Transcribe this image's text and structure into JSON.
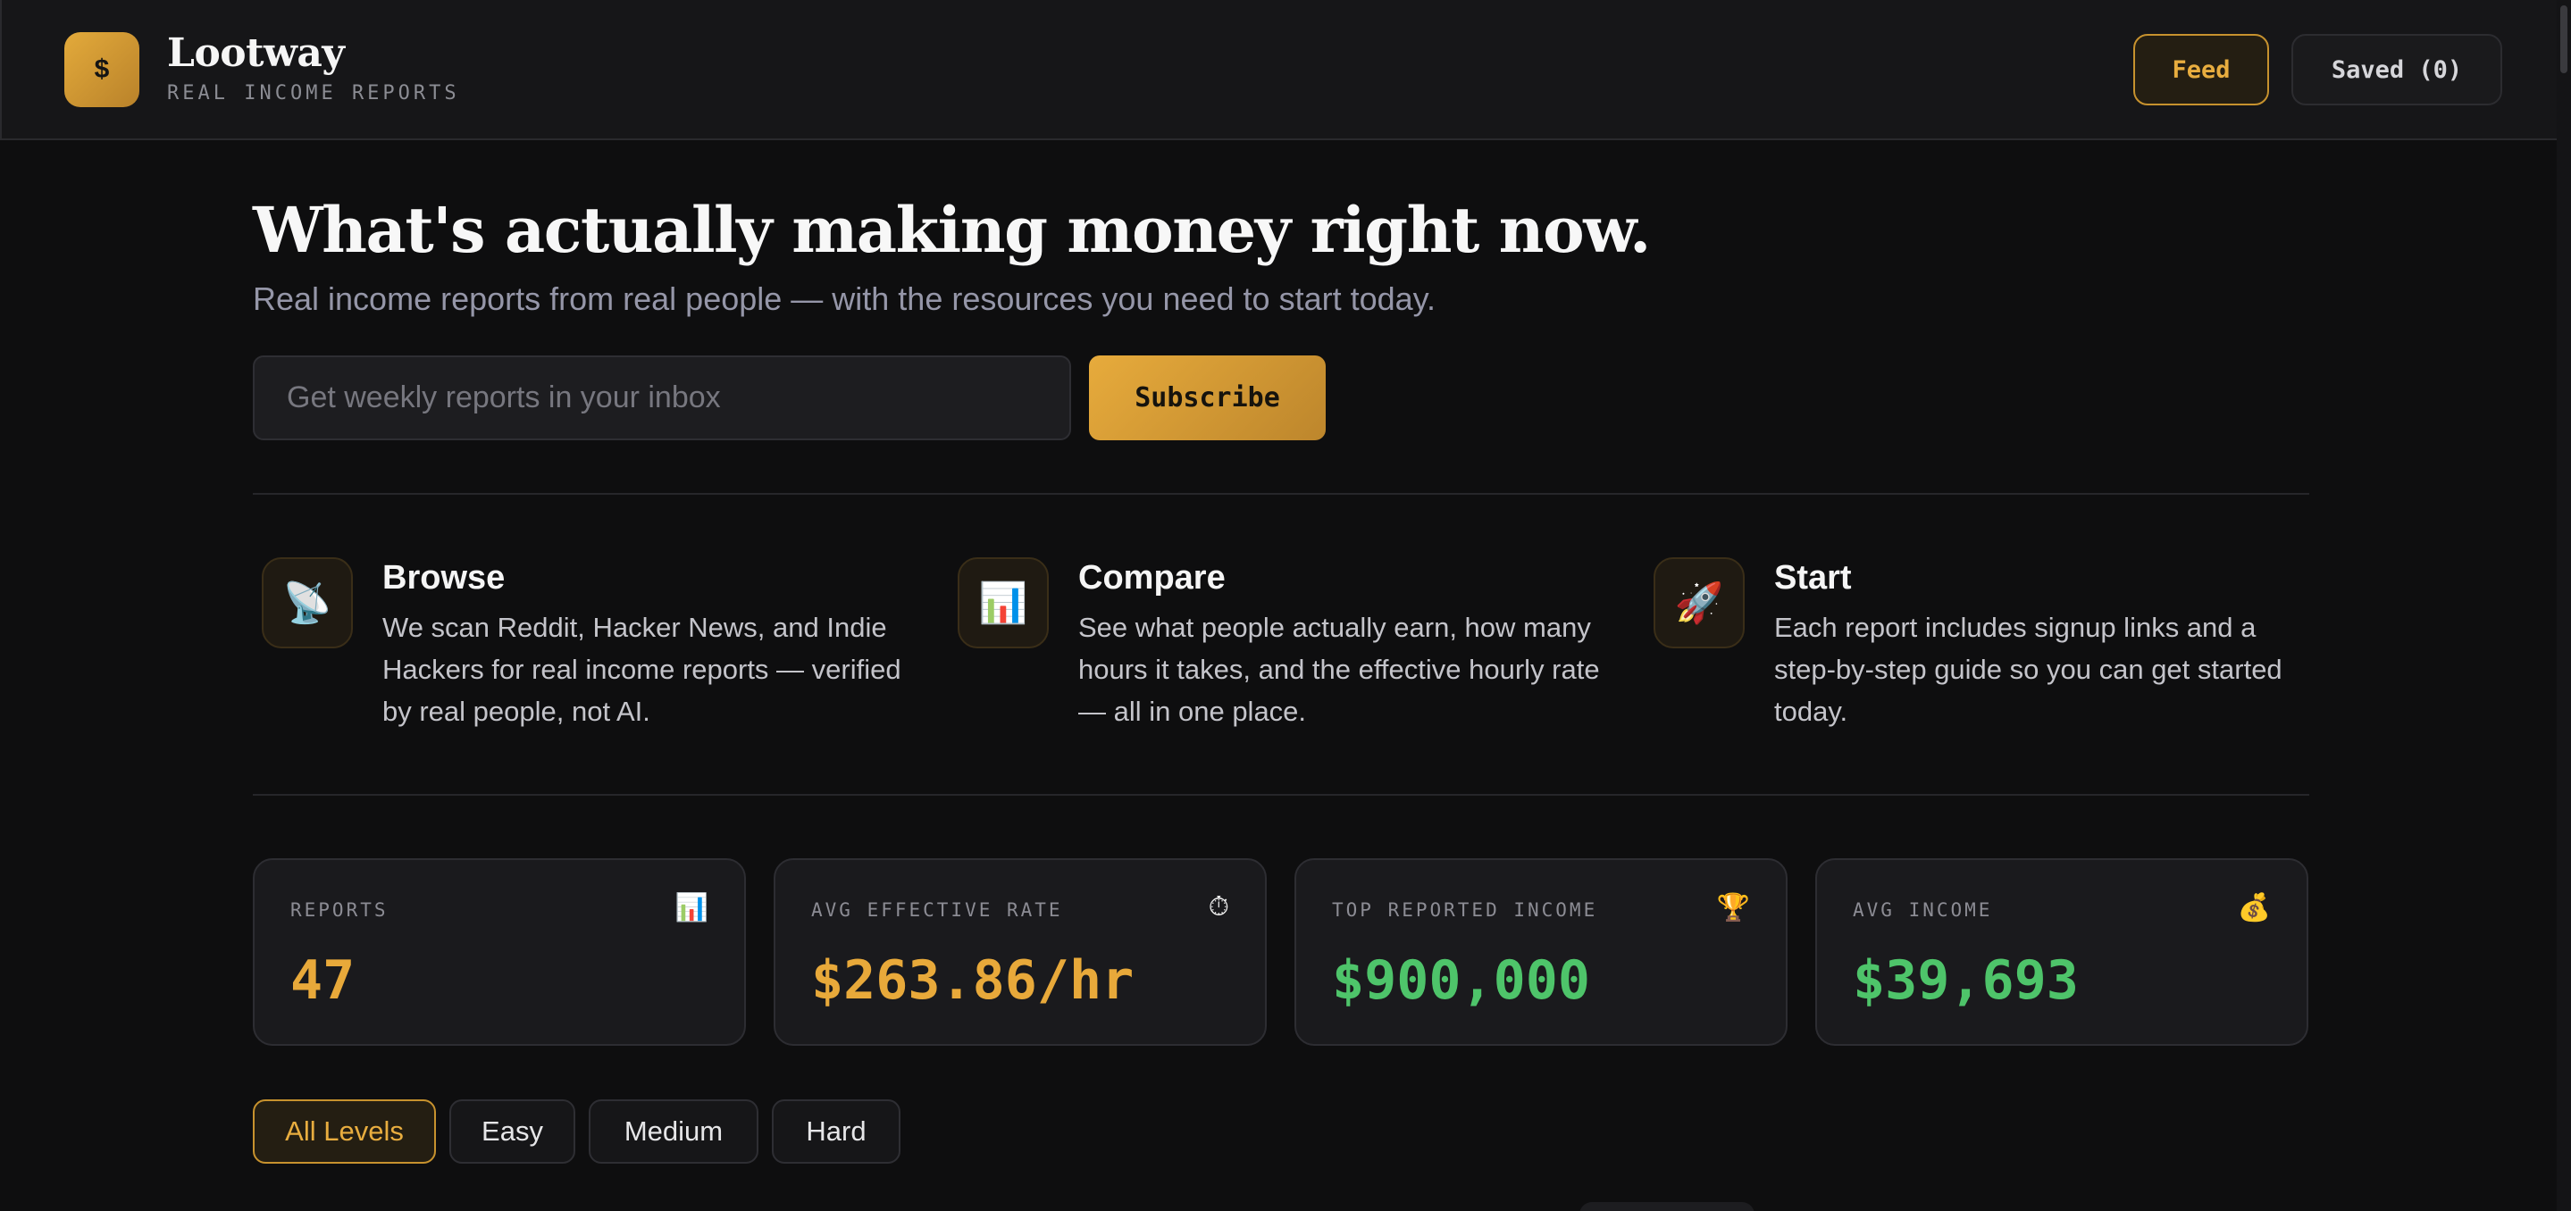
{
  "brand": {
    "logo_symbol": "$",
    "name": "Lootway",
    "tagline": "REAL INCOME REPORTS"
  },
  "nav": {
    "feed_label": "Feed",
    "saved_label": "Saved (0)"
  },
  "hero": {
    "title": "What's actually making money right now.",
    "subtitle": "Real income reports from real people — with the resources you need to start today.",
    "email_placeholder": "Get weekly reports in your inbox",
    "subscribe_label": "Subscribe"
  },
  "features": [
    {
      "icon": "satellite-dish-icon",
      "glyph": "📡",
      "title": "Browse",
      "text": "We scan Reddit, Hacker News, and Indie Hackers for real income reports — verified by real people, not AI."
    },
    {
      "icon": "bar-chart-icon",
      "glyph": "📊",
      "title": "Compare",
      "text": "See what people actually earn, how many hours it takes, and the effective hourly rate — all in one place."
    },
    {
      "icon": "rocket-icon",
      "glyph": "🚀",
      "title": "Start",
      "text": "Each report includes signup links and a step-by-step guide so you can get started today."
    }
  ],
  "stats": [
    {
      "label": "REPORTS",
      "icon": "bar-chart-icon",
      "glyph": "📊",
      "value": "47",
      "color": "#e8a93a"
    },
    {
      "label": "AVG EFFECTIVE RATE",
      "icon": "stopwatch-icon",
      "glyph": "⏱",
      "value": "$263.86/hr",
      "color": "#e8a93a"
    },
    {
      "label": "TOP REPORTED INCOME",
      "icon": "trophy-icon",
      "glyph": "🏆",
      "value": "$900,000",
      "color": "#4ec46a"
    },
    {
      "label": "AVG INCOME",
      "icon": "money-bag-icon",
      "glyph": "💰",
      "value": "$39,693",
      "color": "#4ec46a"
    }
  ],
  "filters": {
    "items": [
      "All Levels",
      "Easy",
      "Medium",
      "Hard"
    ],
    "active": "All Levels"
  },
  "colors": {
    "accent": "#e8ad3f",
    "positive": "#4ec46a",
    "background": "#0e0e0f",
    "surface": "#1a1a1d"
  }
}
